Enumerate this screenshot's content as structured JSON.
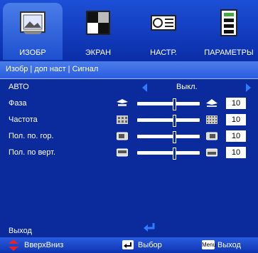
{
  "tabs": [
    {
      "label": "ИЗОБР",
      "icon": "picture-icon",
      "active": true
    },
    {
      "label": "ЭКРАН",
      "icon": "screen-icon",
      "active": false
    },
    {
      "label": "НАСТР.",
      "icon": "projector-settings-icon",
      "active": false
    },
    {
      "label": "ПАРАМЕТРЫ",
      "icon": "options-icon",
      "active": false
    }
  ],
  "breadcrumb": "Изобр | доп наст | Сигнал",
  "menu": {
    "auto": {
      "label": "АВТО",
      "value": "Выкл."
    },
    "items": [
      {
        "label": "Фаза",
        "value": "10",
        "level": 0.57
      },
      {
        "label": "Частота",
        "value": "10",
        "level": 0.57
      },
      {
        "label": "Пол. по. гор.",
        "value": "10",
        "level": 0.57
      },
      {
        "label": "Пол. по верт.",
        "value": "10",
        "level": 0.57
      }
    ],
    "exit_label": "Выход"
  },
  "footer": {
    "updown_label": "ВверхВниз",
    "select_label": "Выбор",
    "menu_key_label": "Menu",
    "exit_label": "Выход"
  },
  "colors": {
    "background": "#0b2a9c",
    "accent": "#2f7bff",
    "updown_icon": "#e8202a"
  }
}
